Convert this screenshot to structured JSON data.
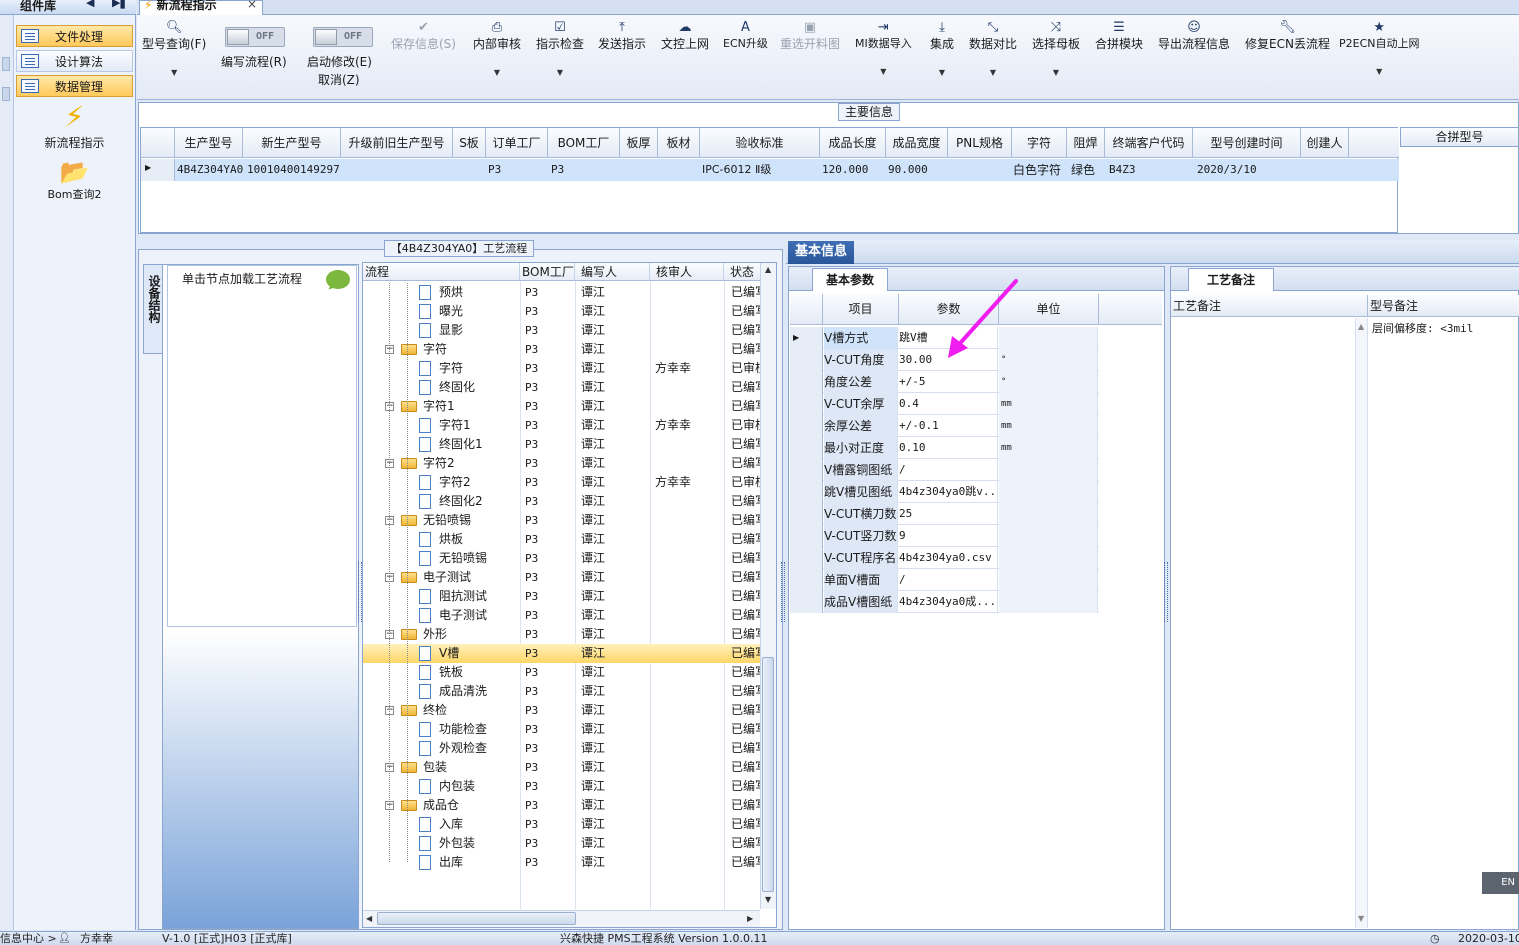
{
  "sidebar": {
    "title": "组件库",
    "categories": [
      {
        "label": "文件处理",
        "active": true
      },
      {
        "label": "设计算法",
        "active": false
      },
      {
        "label": "数据管理",
        "active": true
      }
    ],
    "tools": [
      {
        "label": "新流程指示",
        "icon": "lightning-icon"
      },
      {
        "label": "Bom查询2",
        "icon": "folder-open-icon"
      }
    ]
  },
  "tab": {
    "title": "新流程指示"
  },
  "toolbar": {
    "model_query": "型号查询(F)",
    "toggle_off": "OFF",
    "write_flow": "编写流程(R)",
    "enable_edit": "启动修改(E)",
    "cancel": "取消(Z)",
    "save": "保存信息(S)",
    "internal_review": "内部审核",
    "instruction_check": "指示检查",
    "send_instruction": "发送指示",
    "upload_doc": "文控上网",
    "ecn_upgrade": "ECN升级",
    "reselect_drawing": "重选开料图",
    "mi_import": "MI数据导入",
    "integrate": "集成",
    "data_compare": "数据对比",
    "select_master": "选择母板",
    "merge_module": "合拼模块",
    "export_flow": "导出流程信息",
    "fix_ecn": "修复ECN丢流程",
    "p2ecn": "P2ECN自动上网"
  },
  "main_info": {
    "title": "主要信息",
    "columns": [
      "生产型号",
      "新生产型号",
      "升级前旧生产型号",
      "S板",
      "订单工厂",
      "BOM工厂",
      "板厚",
      "板材",
      "验收标准",
      "成品长度",
      "成品宽度",
      "PNL规格",
      "字符",
      "阻焊",
      "终端客户代码",
      "型号创建时间",
      "创建人"
    ],
    "row": [
      "4B4Z304YA0",
      "10010400149297",
      "",
      "",
      "P3",
      "P3",
      "",
      "",
      "IPC-6012 Ⅱ级",
      "120.000",
      "90.000",
      "",
      "白色字符",
      "绿色",
      "B4Z3",
      "2020/3/10",
      ""
    ],
    "merge_label": "合拼型号"
  },
  "flow": {
    "title": "【4B4Z304YA0】工艺流程",
    "side_tab": "设备结构",
    "hint": "单击节点加载工艺流程",
    "columns": [
      "流程",
      "BOM工厂",
      "编写人",
      "核审人",
      "状态"
    ],
    "rows": [
      {
        "name": "预烘",
        "lvl": 2,
        "bom": "P3",
        "writer": "谭江",
        "reviewer": "",
        "status": "已编写"
      },
      {
        "name": "曝光",
        "lvl": 2,
        "bom": "P3",
        "writer": "谭江",
        "reviewer": "",
        "status": "已编写"
      },
      {
        "name": "显影",
        "lvl": 2,
        "bom": "P3",
        "writer": "谭江",
        "reviewer": "",
        "status": "已编写"
      },
      {
        "name": "字符",
        "lvl": 1,
        "bom": "P3",
        "writer": "谭江",
        "reviewer": "",
        "status": "已编写"
      },
      {
        "name": "字符",
        "lvl": 2,
        "bom": "P3",
        "writer": "谭江",
        "reviewer": "方幸幸",
        "status": "已审核"
      },
      {
        "name": "终固化",
        "lvl": 2,
        "bom": "P3",
        "writer": "谭江",
        "reviewer": "",
        "status": "已编写"
      },
      {
        "name": "字符1",
        "lvl": 1,
        "bom": "P3",
        "writer": "谭江",
        "reviewer": "",
        "status": "已编写"
      },
      {
        "name": "字符1",
        "lvl": 2,
        "bom": "P3",
        "writer": "谭江",
        "reviewer": "方幸幸",
        "status": "已审核"
      },
      {
        "name": "终固化1",
        "lvl": 2,
        "bom": "P3",
        "writer": "谭江",
        "reviewer": "",
        "status": "已编写"
      },
      {
        "name": "字符2",
        "lvl": 1,
        "bom": "P3",
        "writer": "谭江",
        "reviewer": "",
        "status": "已编写"
      },
      {
        "name": "字符2",
        "lvl": 2,
        "bom": "P3",
        "writer": "谭江",
        "reviewer": "方幸幸",
        "status": "已审核"
      },
      {
        "name": "终固化2",
        "lvl": 2,
        "bom": "P3",
        "writer": "谭江",
        "reviewer": "",
        "status": "已编写"
      },
      {
        "name": "无铅喷锡",
        "lvl": 1,
        "bom": "P3",
        "writer": "谭江",
        "reviewer": "",
        "status": "已编写"
      },
      {
        "name": "烘板",
        "lvl": 2,
        "bom": "P3",
        "writer": "谭江",
        "reviewer": "",
        "status": "已编写"
      },
      {
        "name": "无铅喷锡",
        "lvl": 2,
        "bom": "P3",
        "writer": "谭江",
        "reviewer": "",
        "status": "已编写"
      },
      {
        "name": "电子测试",
        "lvl": 1,
        "bom": "P3",
        "writer": "谭江",
        "reviewer": "",
        "status": "已编写"
      },
      {
        "name": "阻抗测试",
        "lvl": 2,
        "bom": "P3",
        "writer": "谭江",
        "reviewer": "",
        "status": "已编写"
      },
      {
        "name": "电子测试",
        "lvl": 2,
        "bom": "P3",
        "writer": "谭江",
        "reviewer": "",
        "status": "已编写"
      },
      {
        "name": "外形",
        "lvl": 1,
        "bom": "P3",
        "writer": "谭江",
        "reviewer": "",
        "status": "已编写"
      },
      {
        "name": "V槽",
        "lvl": 2,
        "bom": "P3",
        "writer": "谭江",
        "reviewer": "",
        "status": "已编写",
        "selected": true
      },
      {
        "name": "铣板",
        "lvl": 2,
        "bom": "P3",
        "writer": "谭江",
        "reviewer": "",
        "status": "已编写"
      },
      {
        "name": "成品清洗",
        "lvl": 2,
        "bom": "P3",
        "writer": "谭江",
        "reviewer": "",
        "status": "已编写"
      },
      {
        "name": "终检",
        "lvl": 1,
        "bom": "P3",
        "writer": "谭江",
        "reviewer": "",
        "status": "已编写"
      },
      {
        "name": "功能检查",
        "lvl": 2,
        "bom": "P3",
        "writer": "谭江",
        "reviewer": "",
        "status": "已编写"
      },
      {
        "name": "外观检查",
        "lvl": 2,
        "bom": "P3",
        "writer": "谭江",
        "reviewer": "",
        "status": "已编写"
      },
      {
        "name": "包装",
        "lvl": 1,
        "bom": "P3",
        "writer": "谭江",
        "reviewer": "",
        "status": "已编写"
      },
      {
        "name": "内包装",
        "lvl": 2,
        "bom": "P3",
        "writer": "谭江",
        "reviewer": "",
        "status": "已编写"
      },
      {
        "name": "成品仓",
        "lvl": 1,
        "bom": "P3",
        "writer": "谭江",
        "reviewer": "",
        "status": "已编写"
      },
      {
        "name": "入库",
        "lvl": 2,
        "bom": "P3",
        "writer": "谭江",
        "reviewer": "",
        "status": "已编写"
      },
      {
        "name": "外包装",
        "lvl": 2,
        "bom": "P3",
        "writer": "谭江",
        "reviewer": "",
        "status": "已编写"
      },
      {
        "name": "出库",
        "lvl": 2,
        "bom": "P3",
        "writer": "谭江",
        "reviewer": "",
        "status": "已编写"
      }
    ]
  },
  "basic": {
    "title": "基本信息",
    "param_tab": "基本参数",
    "columns": [
      "项目",
      "参数",
      "单位"
    ],
    "params": [
      {
        "k": "V槽方式",
        "v": "跳V槽",
        "u": ""
      },
      {
        "k": "V-CUT角度",
        "v": "30.00",
        "u": "°"
      },
      {
        "k": "角度公差",
        "v": "+/-5",
        "u": "°"
      },
      {
        "k": "V-CUT余厚",
        "v": "0.4",
        "u": "mm"
      },
      {
        "k": "余厚公差",
        "v": "+/-0.1",
        "u": "mm"
      },
      {
        "k": "最小对正度",
        "v": "0.10",
        "u": "mm"
      },
      {
        "k": "V槽露铜图纸",
        "v": "/",
        "u": ""
      },
      {
        "k": "跳V槽见图纸",
        "v": "4b4z304ya0跳v...",
        "u": ""
      },
      {
        "k": "V-CUT横刀数",
        "v": "25",
        "u": ""
      },
      {
        "k": "V-CUT竖刀数",
        "v": "9",
        "u": ""
      },
      {
        "k": "V-CUT程序名",
        "v": "4b4z304ya0.csv",
        "u": ""
      },
      {
        "k": "单面V槽面",
        "v": "/",
        "u": ""
      },
      {
        "k": "成品V槽图纸",
        "v": "4b4z304ya0成...",
        "u": ""
      }
    ],
    "arrow_color": "#f01df0"
  },
  "notes": {
    "tab": "工艺备注",
    "col_left": "工艺备注",
    "col_right": "型号备注",
    "right_value": "层间偏移度: <3mil"
  },
  "ime": "EN",
  "statusbar": {
    "left": "信息中心 >",
    "user": "方幸幸",
    "version": "V-1.0 [正式]H03 [正式库]",
    "center": "兴森快捷 PMS工程系统 Version 1.0.0.11",
    "right": "2020-03-10"
  }
}
